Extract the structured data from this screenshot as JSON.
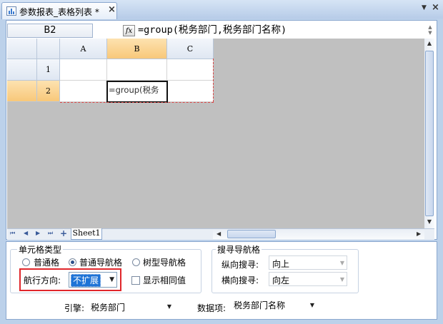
{
  "tab": {
    "title": "参数报表_表格列表 *",
    "close": "×"
  },
  "strip": {
    "arrow": "▼",
    "close": "×"
  },
  "formula_bar": {
    "cell_ref": "B2",
    "fx": "fx",
    "formula": "=group(税务部门,税务部门名称)"
  },
  "grid": {
    "columns": [
      "A",
      "B",
      "C"
    ],
    "rows": [
      "1",
      "2"
    ],
    "selected_cell_text": "=group(税务"
  },
  "sheet": {
    "tab": "Sheet1",
    "nav": [
      "⏮",
      "◀",
      "▶",
      "⏭",
      "+"
    ]
  },
  "panel": {
    "cell_type": {
      "title": "单元格类型",
      "options": [
        "普通格",
        "普通导航格",
        "树型导航格"
      ],
      "selected": "普通导航格"
    },
    "nav_direction": {
      "label": "航行方向:",
      "value": "不扩展"
    },
    "show_same": {
      "label": "显示相同值",
      "checked": false
    },
    "search_nav": {
      "title": "搜寻导航格",
      "vertical": {
        "label": "纵向搜寻:",
        "value": "向上"
      },
      "horizontal": {
        "label": "横向搜寻:",
        "value": "向左"
      }
    },
    "engine": {
      "label": "引擎:",
      "value": "税务部门"
    },
    "data_item": {
      "label": "数据项:",
      "value": "税务部门名称"
    }
  },
  "colors": {
    "accent": "#f8c87a",
    "highlight": "#e0262b",
    "selection": "#1e73d6"
  }
}
